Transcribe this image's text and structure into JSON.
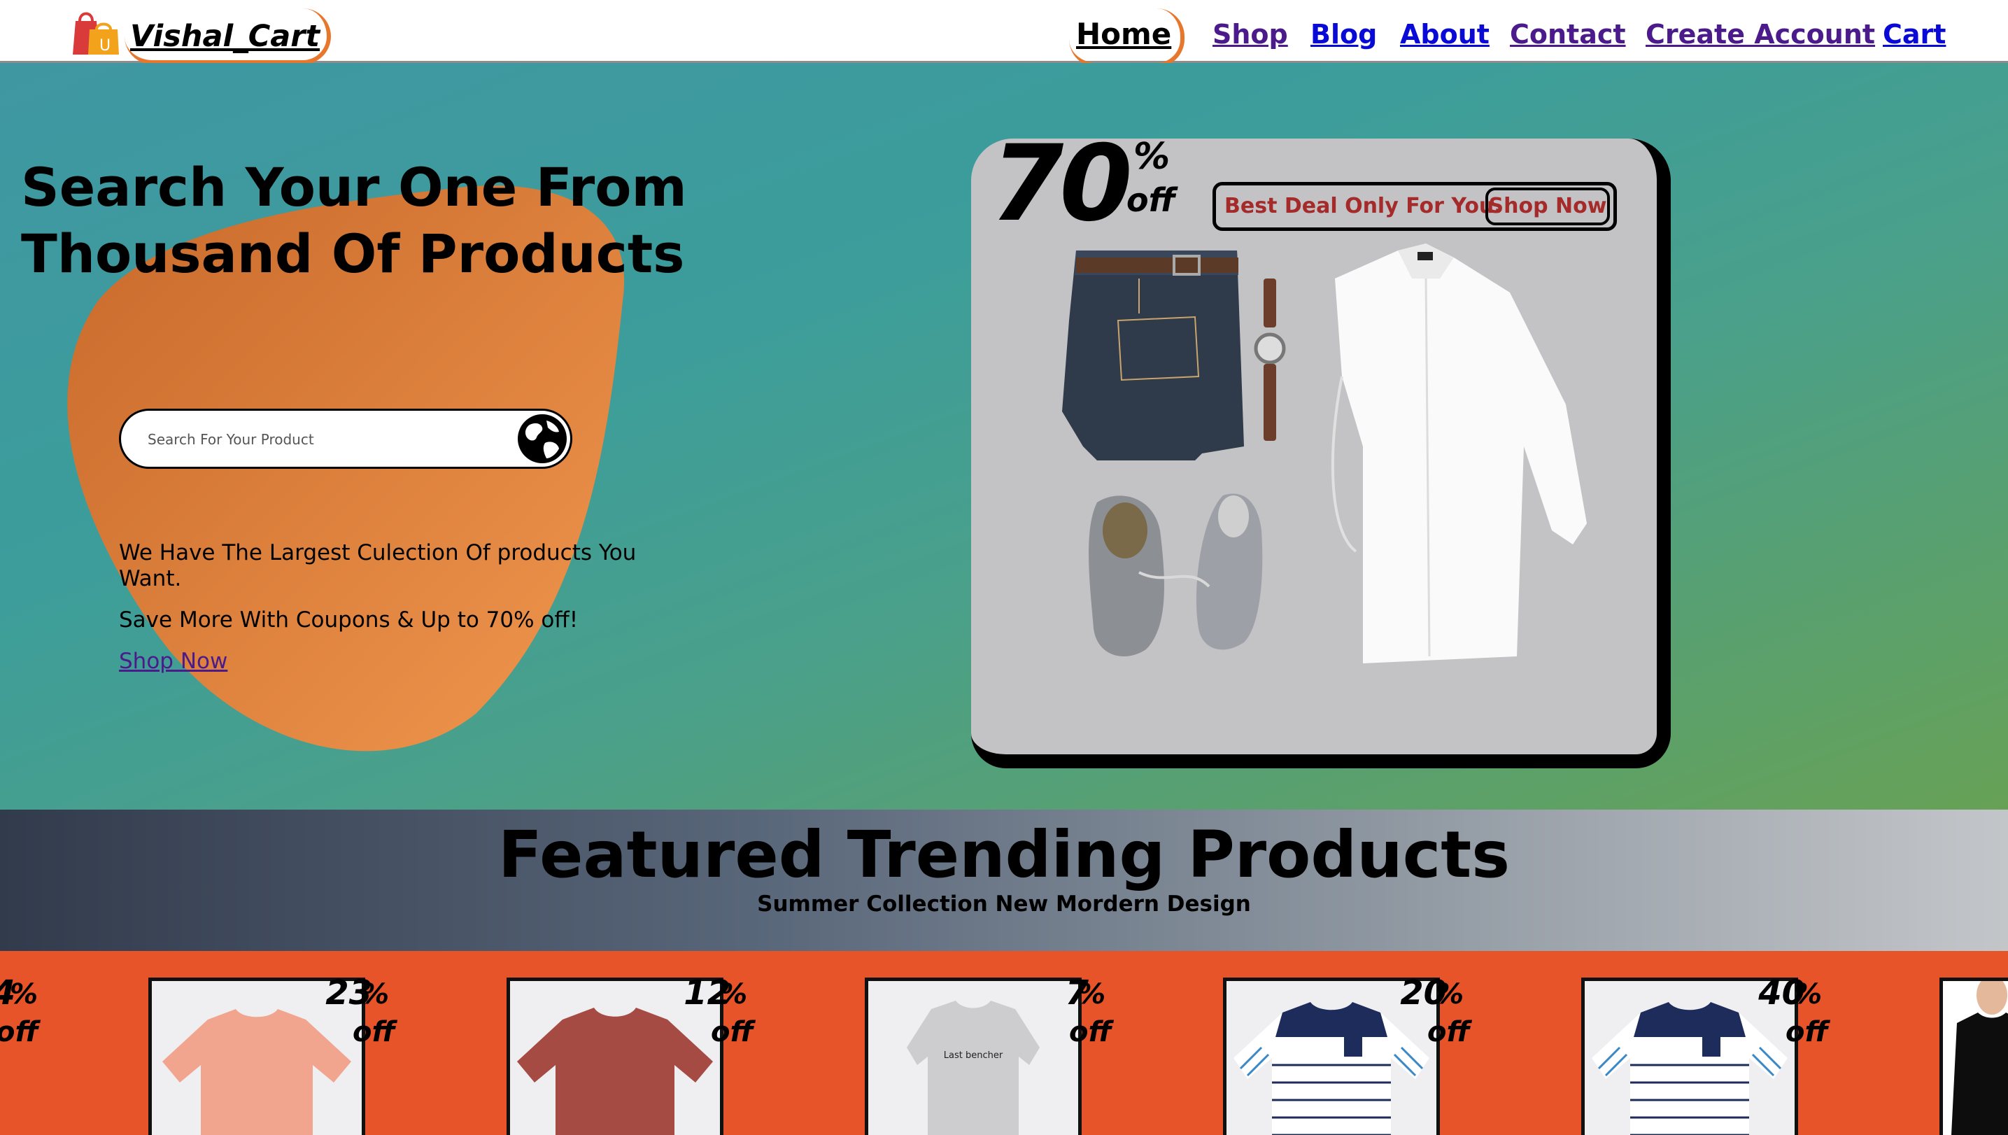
{
  "header": {
    "brand": "Vishal_Cart",
    "logo_icon": "shopping-bags-icon",
    "nav": [
      {
        "label": "Home",
        "active": true
      },
      {
        "label": "Shop"
      },
      {
        "label": "Blog"
      },
      {
        "label": "About"
      },
      {
        "label": "Contact"
      },
      {
        "label": "Create Account"
      },
      {
        "label": "Cart"
      }
    ]
  },
  "hero": {
    "title": "Search Your One From Thousand Of Products",
    "search": {
      "placeholder": "Search For Your Product",
      "icon": "globe-icon"
    },
    "description": "We Have The Largest Culection Of products You Want.",
    "coupon_text": "Save More With Coupons & Up to 70% off!",
    "shop_link": "Shop Now",
    "deal": {
      "percent": "70",
      "percent_sign": "%",
      "off": "off",
      "banner_text": "Best Deal Only For You.",
      "banner_button": "Shop Now"
    }
  },
  "featured": {
    "title": "Featured Trending Products",
    "subtitle": "Summer Collection New Mordern Design"
  },
  "products": [
    {
      "discount": "4",
      "image": "tshirt-partial"
    },
    {
      "discount": "23",
      "image": "peach-tshirt"
    },
    {
      "discount": "12",
      "image": "brick-red-tshirt"
    },
    {
      "discount": "7",
      "image": "grey-printed-tshirt",
      "print_text": "Last bencher"
    },
    {
      "discount": "20",
      "image": "navy-striped-tshirt"
    },
    {
      "discount": "40",
      "image": "navy-striped-tshirt"
    },
    {
      "discount": "",
      "image": "black-tshirt-model"
    }
  ],
  "discount_suffix": {
    "percent": "%",
    "off": "off"
  },
  "colors": {
    "accent_orange": "#e8772e",
    "product_band": "#e8542a",
    "link_blue": "#0a0ad6",
    "link_visited": "#4b1b8c",
    "deal_text": "#a52a2a"
  }
}
